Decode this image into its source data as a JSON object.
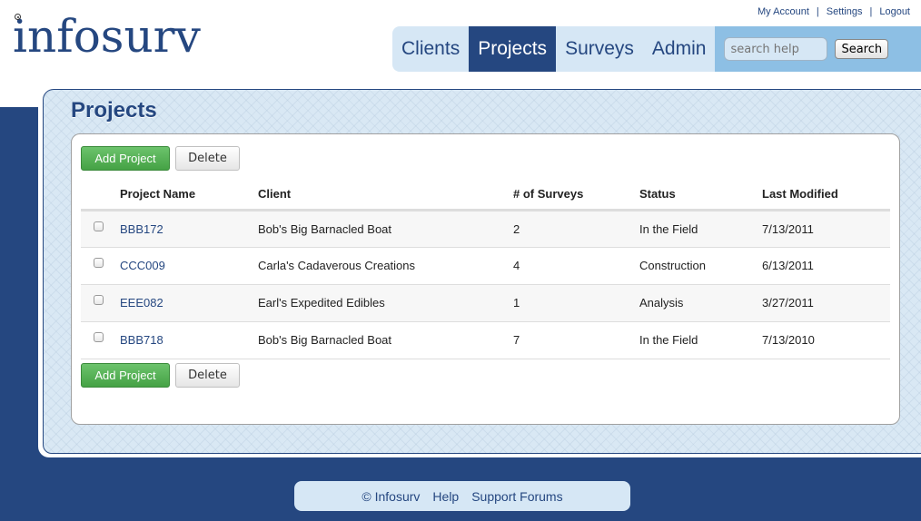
{
  "brand": {
    "logo_text": "infosurv"
  },
  "utility_links": [
    {
      "label": "My Account"
    },
    {
      "label": "Settings"
    },
    {
      "label": "Logout"
    }
  ],
  "utility_separator": "|",
  "nav": {
    "tabs": [
      {
        "label": "Clients",
        "active": false
      },
      {
        "label": "Projects",
        "active": true
      },
      {
        "label": "Surveys",
        "active": false
      },
      {
        "label": "Admin",
        "active": false
      }
    ],
    "search": {
      "placeholder": "search help",
      "value": "",
      "button_label": "Search"
    }
  },
  "page": {
    "title": "Projects",
    "add_label": "Add Project",
    "delete_label": "Delete",
    "table": {
      "columns": [
        "",
        "Project Name",
        "Client",
        "# of Surveys",
        "Status",
        "Last Modified"
      ],
      "rows": [
        {
          "checked": false,
          "name": "BBB172",
          "client": "Bob's Big Barnacled Boat",
          "surveys": "2",
          "status": "In the Field",
          "modified": "7/13/2011"
        },
        {
          "checked": false,
          "name": "CCC009",
          "client": "Carla's Cadaverous Creations",
          "surveys": "4",
          "status": "Construction",
          "modified": "6/13/2011"
        },
        {
          "checked": false,
          "name": "EEE082",
          "client": "Earl's Expedited Edibles",
          "surveys": "1",
          "status": "Analysis",
          "modified": "3/27/2011"
        },
        {
          "checked": false,
          "name": "BBB718",
          "client": "Bob's Big Barnacled Boat",
          "surveys": "7",
          "status": "In the Field",
          "modified": "7/13/2010"
        }
      ]
    }
  },
  "footer": {
    "copyright": "© Infosurv",
    "links": [
      {
        "label": "Help"
      },
      {
        "label": "Support Forums"
      }
    ]
  },
  "colors": {
    "brand_blue": "#254780",
    "light_blue": "#d6e7f5",
    "search_bar_blue": "#8dbfe4",
    "add_green": "#45a245"
  }
}
